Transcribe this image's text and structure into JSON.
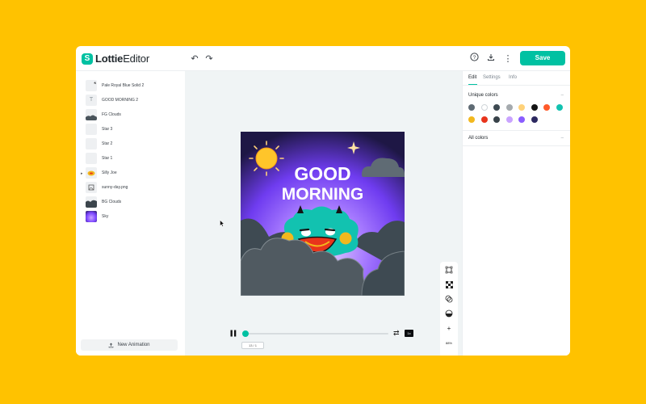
{
  "brand": {
    "name_bold": "Lottie",
    "name_regular": "Editor",
    "badge": "S"
  },
  "toolbar": {
    "save_label": "Save",
    "undo_icon": "undo-icon",
    "redo_icon": "redo-icon",
    "help_icon": "help-icon",
    "download_icon": "download-icon",
    "more_icon": "more-vertical-icon"
  },
  "layers": [
    {
      "label": "Pale Royal Blue Solid 2",
      "thumb": "shape"
    },
    {
      "label": "GOOD MORNING 2",
      "thumb": "text"
    },
    {
      "label": "FG Clouds",
      "thumb": "cloud"
    },
    {
      "label": "Star 3",
      "thumb": "blank"
    },
    {
      "label": "Star 2",
      "thumb": "blank"
    },
    {
      "label": "Star 1",
      "thumb": "blank"
    },
    {
      "label": "Silly Joe",
      "thumb": "joe",
      "expandable": true
    },
    {
      "label": "sunny-day.png",
      "thumb": "image"
    },
    {
      "label": "BG Clouds",
      "thumb": "bgcloud"
    },
    {
      "label": "Sky",
      "thumb": "sky"
    }
  ],
  "left_footer": {
    "new_animation_label": "New Animation",
    "icon": "upload-icon"
  },
  "artwork": {
    "text_line1": "GOOD",
    "text_line2": "MORNING"
  },
  "view_tools": [
    "select-frame-icon",
    "checkerboard-icon",
    "overlap-icon",
    "fill-icon",
    "zoom-in-icon",
    "zoom-level",
    "zoom-out-icon"
  ],
  "zoom_level": "88%",
  "playback": {
    "state": "paused",
    "progress": 0.02,
    "frame_label": "13 / 1",
    "speed_label": "1x"
  },
  "right_panel": {
    "tabs": [
      "Edit",
      "Settings",
      "Info"
    ],
    "active_tab": "Edit",
    "unique_colors_title": "Unique colors",
    "all_colors_title": "All colors",
    "colors": [
      "#5F6B74",
      "#FFFFFF",
      "#3E4A52",
      "#A5AAAE",
      "#FFD27A",
      "#141414",
      "#FF5A2A",
      "#12C2B0",
      "#F2B81E",
      "#E8341C",
      "#384249",
      "#C9A3FF",
      "#8A5CFF",
      "#2C2860"
    ]
  }
}
